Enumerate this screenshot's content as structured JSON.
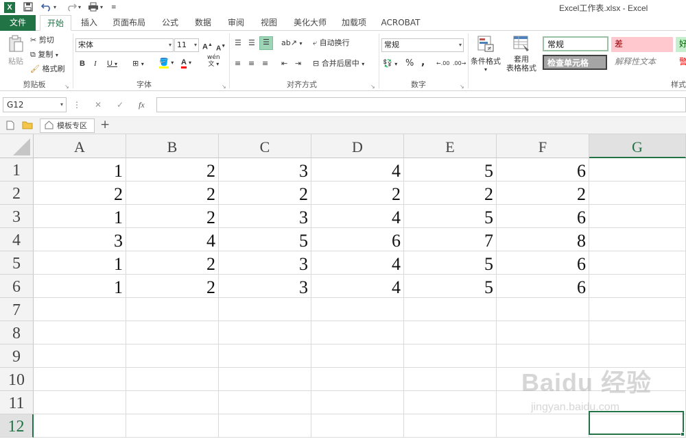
{
  "window": {
    "title": "Excel工作表.xlsx - Excel",
    "logo": "X"
  },
  "quick_access": {
    "save_icon": "save-icon",
    "undo_icon": "undo-icon",
    "redo_icon": "redo-icon",
    "customize_icon": "customize-icon"
  },
  "tabs": [
    {
      "label": "文件"
    },
    {
      "label": "开始"
    },
    {
      "label": "插入"
    },
    {
      "label": "页面布局"
    },
    {
      "label": "公式"
    },
    {
      "label": "数据"
    },
    {
      "label": "审阅"
    },
    {
      "label": "视图"
    },
    {
      "label": "美化大师"
    },
    {
      "label": "加载项"
    },
    {
      "label": "ACROBAT"
    }
  ],
  "clipboard": {
    "paste": "粘贴",
    "cut": "剪切",
    "copy": "复制",
    "format_painter": "格式刷",
    "label": "剪贴板"
  },
  "font": {
    "name": "宋体",
    "size": "11",
    "bold": "B",
    "italic": "I",
    "underline": "U",
    "label": "字体",
    "grow": "A",
    "shrink": "A",
    "font_color_letter": "A",
    "wen": "wén",
    "wen_char": "文"
  },
  "alignment": {
    "wrap": "自动换行",
    "merge": "合并后居中",
    "label": "对齐方式"
  },
  "number": {
    "format": "常规",
    "percent": "%",
    "comma": ",",
    "inc_decimal": ".00",
    "dec_decimal": ".00",
    "label": "数字"
  },
  "styles": {
    "conditional": "条件格式",
    "table_format": "套用\n表格格式",
    "normal": "常规",
    "bad": "差",
    "good": "好",
    "check_cell": "检查单元格",
    "explanatory": "解释性文本",
    "warning": "警",
    "label": "样式"
  },
  "formula_bar": {
    "name_box": "G12",
    "cancel": "✕",
    "enter": "✓",
    "fx": "fx",
    "value": ""
  },
  "sheet_tabs": {
    "template": "模板专区",
    "add": "+"
  },
  "grid": {
    "columns": [
      "A",
      "B",
      "C",
      "D",
      "E",
      "F",
      "G"
    ],
    "selected_column": "G",
    "rows": [
      "1",
      "2",
      "3",
      "4",
      "5",
      "6",
      "7",
      "8",
      "9",
      "10",
      "11",
      "12"
    ],
    "selected_row": "12",
    "values": [
      [
        "1",
        "2",
        "3",
        "4",
        "5",
        "6",
        ""
      ],
      [
        "2",
        "2",
        "2",
        "2",
        "2",
        "2",
        ""
      ],
      [
        "1",
        "2",
        "3",
        "4",
        "5",
        "6",
        ""
      ],
      [
        "3",
        "4",
        "5",
        "6",
        "7",
        "8",
        ""
      ],
      [
        "1",
        "2",
        "3",
        "4",
        "5",
        "6",
        ""
      ],
      [
        "1",
        "2",
        "3",
        "4",
        "5",
        "6",
        ""
      ]
    ]
  },
  "colors": {
    "excel_green": "#217346",
    "bad_bg": "#ffc7ce",
    "bad_fg": "#9c0006",
    "good_bg": "#c6efce",
    "check_bg": "#a5a5a5"
  },
  "watermark": {
    "line1": "Baidu 经验",
    "line2": "jingyan.baidu.com"
  }
}
